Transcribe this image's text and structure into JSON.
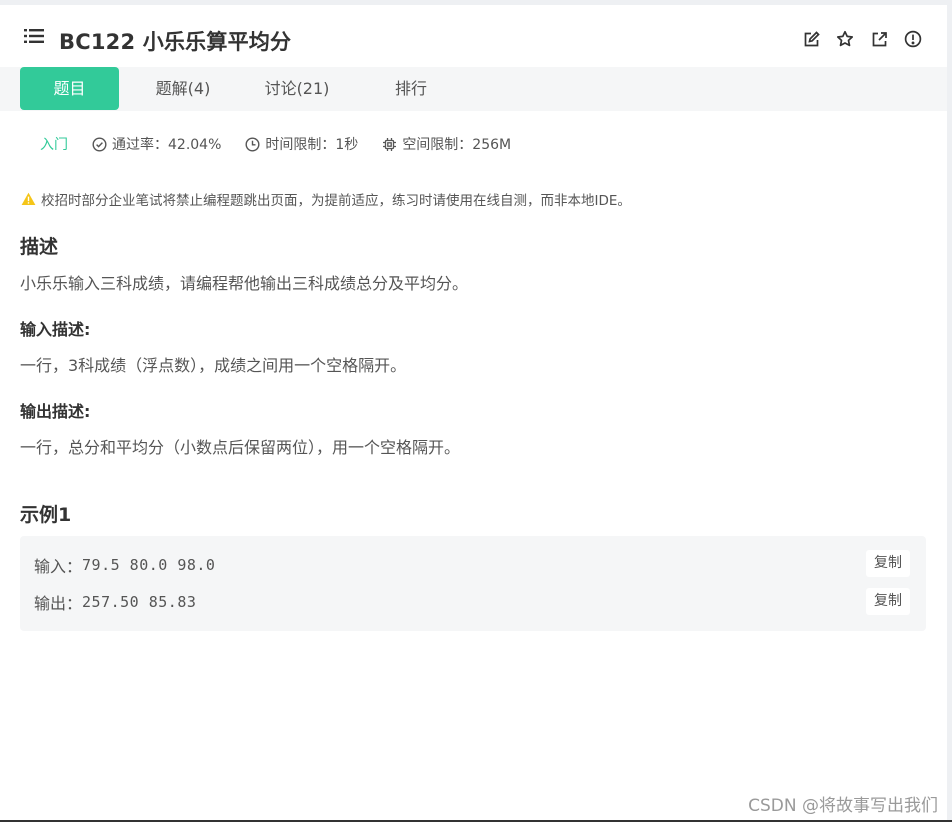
{
  "header": {
    "title": "BC122  小乐乐算平均分",
    "icons": [
      "list-icon",
      "edit-icon",
      "star-icon",
      "external-link-icon",
      "info-icon"
    ]
  },
  "tabs": [
    {
      "label": "题目",
      "active": true
    },
    {
      "label": "题解(4)",
      "active": false
    },
    {
      "label": "讨论(21)",
      "active": false
    },
    {
      "label": "排行",
      "active": false
    }
  ],
  "meta": {
    "difficulty": "入门",
    "pass_rate": "通过率：42.04%",
    "time_limit": "时间限制：1秒",
    "memory_limit": "空间限制：256M"
  },
  "notice": "校招时部分企业笔试将禁止编程题跳出页面，为提前适应，练习时请使用在线自测，而非本地IDE。",
  "description": {
    "heading": "描述",
    "text": "小乐乐输入三科成绩，请编程帮他输出三科成绩总分及平均分。"
  },
  "input_desc": {
    "heading": "输入描述:",
    "text": "一行，3科成绩（浮点数），成绩之间用一个空格隔开。"
  },
  "output_desc": {
    "heading": "输出描述:",
    "text": "一行，总分和平均分（小数点后保留两位），用一个空格隔开。"
  },
  "example": {
    "heading": "示例1",
    "input_label": "输入：",
    "input_value": "79.5 80.0 98.0",
    "output_label": "输出：",
    "output_value": "257.50 85.83",
    "copy_label": "复制"
  },
  "watermark": "CSDN @将故事写出我们",
  "colors": {
    "accent": "#32ca99",
    "warning": "#f5c518",
    "tab_bar_bg": "#f5f6f7"
  }
}
